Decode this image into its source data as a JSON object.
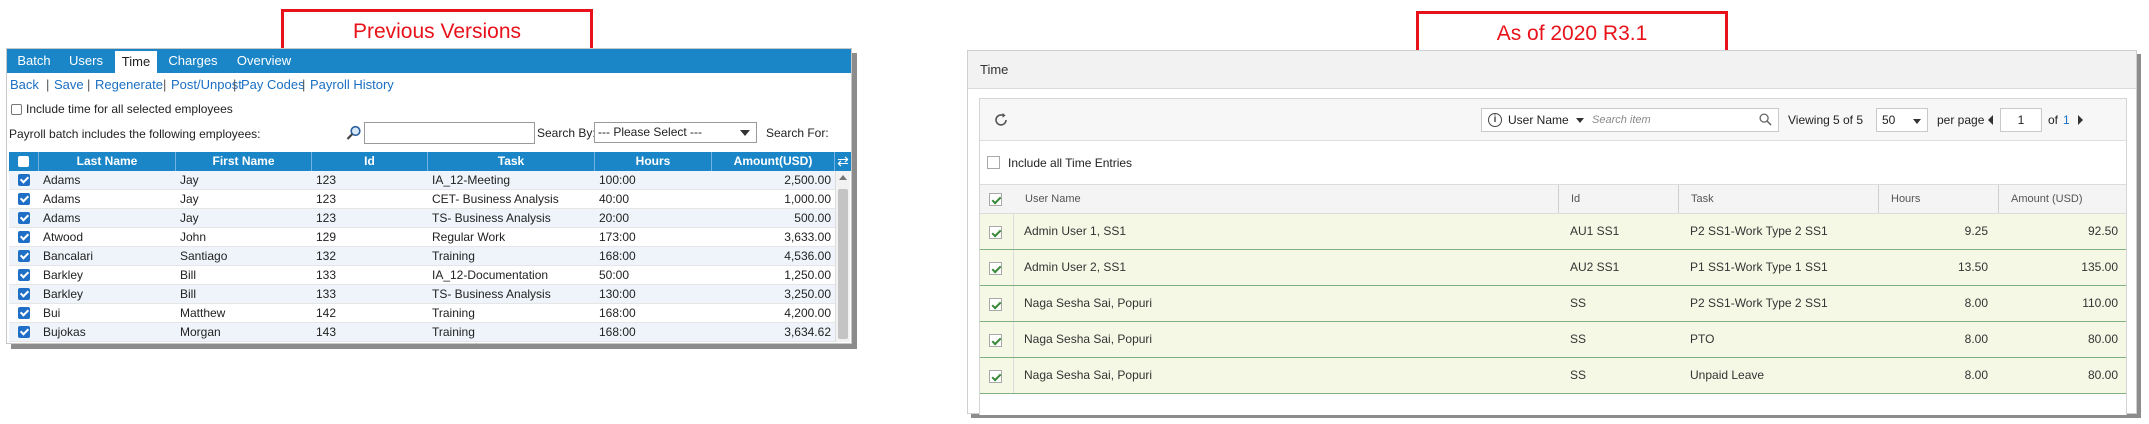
{
  "callouts": {
    "previous": "Previous Versions",
    "current": "As of 2020 R3.1"
  },
  "old": {
    "tabs": [
      "Batch",
      "Users",
      "Time",
      "Charges",
      "Overview"
    ],
    "active_tab": "Time",
    "links": [
      "Back",
      "Save",
      "Regenerate",
      "Post/Unpost",
      "Pay Codes",
      "Payroll History"
    ],
    "link_separator": "|",
    "include_all_label": "Include time for all selected employees",
    "includes_text": "Payroll batch includes the following employees:",
    "search_by_label": "Search By:",
    "search_select_value": "--- Please Select ---",
    "search_for_label": "Search For:",
    "columns": [
      "Last Name",
      "First Name",
      "Id",
      "Task",
      "Hours",
      "Amount(USD)"
    ],
    "rows": [
      [
        "Adams",
        "Jay",
        "123",
        "IA_12-Meeting",
        "100:00",
        "2,500.00"
      ],
      [
        "Adams",
        "Jay",
        "123",
        "CET- Business Analysis",
        "40:00",
        "1,000.00"
      ],
      [
        "Adams",
        "Jay",
        "123",
        "TS- Business Analysis",
        "20:00",
        "500.00"
      ],
      [
        "Atwood",
        "John",
        "129",
        "Regular Work",
        "173:00",
        "3,633.00"
      ],
      [
        "Bancalari",
        "Santiago",
        "132",
        "Training",
        "168:00",
        "4,536.00"
      ],
      [
        "Barkley",
        "Bill",
        "133",
        "IA_12-Documentation",
        "50:00",
        "1,250.00"
      ],
      [
        "Barkley",
        "Bill",
        "133",
        "TS- Business Analysis",
        "130:00",
        "3,250.00"
      ],
      [
        "Bui",
        "Matthew",
        "142",
        "Training",
        "168:00",
        "4,200.00"
      ],
      [
        "Bujokas",
        "Morgan",
        "143",
        "Training",
        "168:00",
        "3,634.62"
      ]
    ]
  },
  "new": {
    "title": "Time",
    "search_field": "User Name",
    "search_placeholder": "Search item",
    "viewing_label": "Viewing",
    "viewing_range": "5 of 5",
    "page_size": "50",
    "per_page_label": "per page",
    "page_number": "1",
    "of_label": "of",
    "total_pages": "1",
    "include_all_label": "Include all Time Entries",
    "columns": [
      "User Name",
      "Id",
      "Task",
      "Hours",
      "Amount (USD)"
    ],
    "rows": [
      [
        "Admin User 1, SS1",
        "AU1 SS1",
        "P2 SS1-Work Type 2 SS1",
        "9.25",
        "92.50"
      ],
      [
        "Admin User 2, SS1",
        "AU2 SS1",
        "P1 SS1-Work Type 1 SS1",
        "13.50",
        "135.00"
      ],
      [
        "Naga Sesha Sai, Popuri",
        "SS",
        "P2 SS1-Work Type 2 SS1",
        "8.00",
        "110.00"
      ],
      [
        "Naga Sesha Sai, Popuri",
        "SS",
        "PTO",
        "8.00",
        "80.00"
      ],
      [
        "Naga Sesha Sai, Popuri",
        "SS",
        "Unpaid Leave",
        "8.00",
        "80.00"
      ]
    ]
  }
}
